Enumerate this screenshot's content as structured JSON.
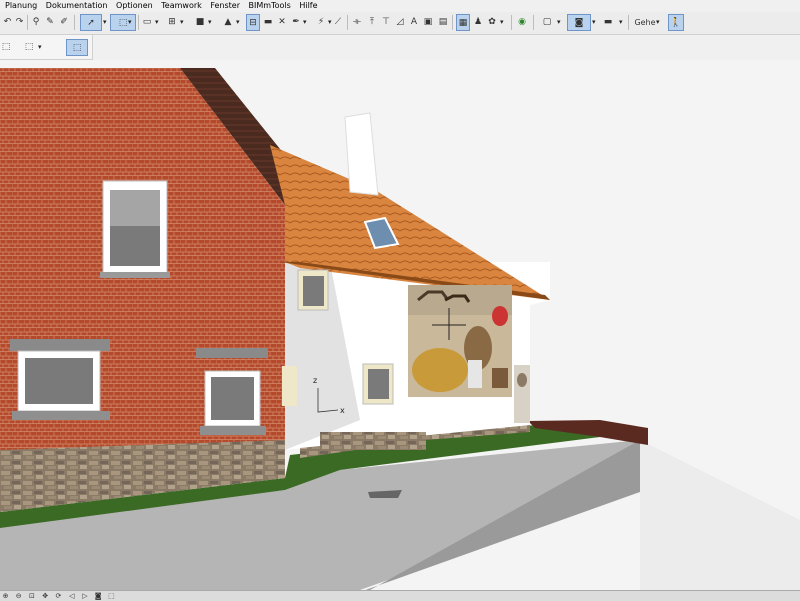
{
  "menu": {
    "items": [
      "Planung",
      "Dokumentation",
      "Optionen",
      "Teamwork",
      "Fenster",
      "BIMmTools",
      "Hilfe"
    ]
  },
  "toolbar": {
    "navigation_label": "Gehe",
    "icons": [
      "undo-icon",
      "redo-icon",
      "find-select-icon",
      "eyedropper-icon",
      "syringe-icon",
      "arrow-tool-icon",
      "marquee-tool-icon",
      "wall-icon",
      "grid-icon",
      "object-icon",
      "stair-icon",
      "window-icon",
      "close-x-icon",
      "pen-icon",
      "magic-wand-icon",
      "dimension-icon",
      "measure-icon",
      "elevation-icon",
      "marker-icon",
      "label-icon",
      "image-icon",
      "layer-icon",
      "material-icon",
      "render-icon",
      "globe-icon",
      "view-icon",
      "camera-icon",
      "display-icon",
      "walk-icon"
    ]
  },
  "viewport": {
    "axis_labels": {
      "z": "z",
      "x": "x"
    },
    "colors": {
      "background": "#f4f4f4",
      "brick": "#b5492b",
      "roof_tiles": "#d9853f",
      "plaster": "#ffffff",
      "grass": "#3b6a25",
      "road": "#b5b5b5",
      "stone_base": "#8a7a66"
    }
  },
  "statusbar": {
    "icons": [
      "zoom-in-icon",
      "zoom-out-icon",
      "zoom-fit-icon",
      "pan-icon",
      "orbit-icon",
      "zoom-previous-icon",
      "zoom-next-icon",
      "camera-icon",
      "fit-window-icon"
    ]
  }
}
